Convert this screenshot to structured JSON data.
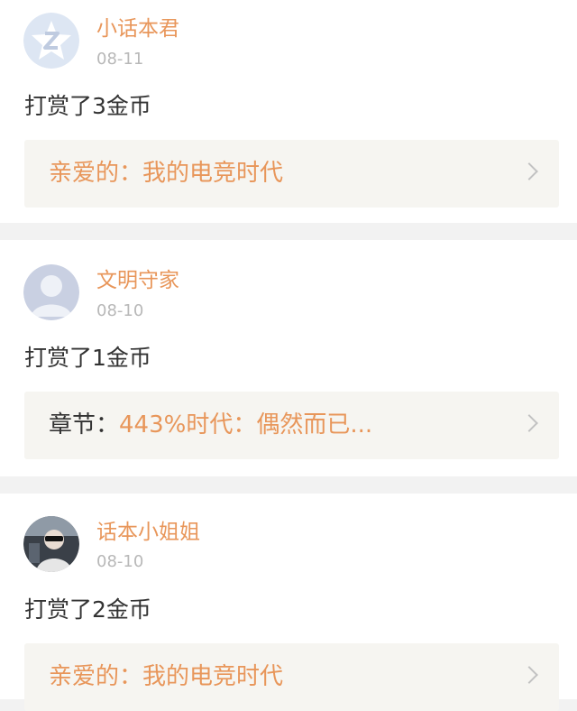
{
  "feed": [
    {
      "user": "小话本君",
      "date": "08-11",
      "reward": "打赏了3金币",
      "link_prefix": "亲爱的：",
      "link_title": "我的电竞时代",
      "avatar": "qq-star-icon"
    },
    {
      "user": "文明守家",
      "date": "08-10",
      "reward": "打赏了1金币",
      "link_prefix": "章节：",
      "link_title": "443%时代：偶然而已...",
      "avatar": "default-person-icon"
    },
    {
      "user": "话本小姐姐",
      "date": "08-10",
      "reward": "打赏了2金币",
      "link_prefix": "亲爱的：",
      "link_title": "我的电竞时代",
      "avatar": "photo-avatar"
    }
  ],
  "colors": {
    "accent": "#e8965a",
    "text": "#333333",
    "muted": "#b8b8b8",
    "link_bg": "#f6f5f1",
    "separator": "#f2f2f2"
  }
}
